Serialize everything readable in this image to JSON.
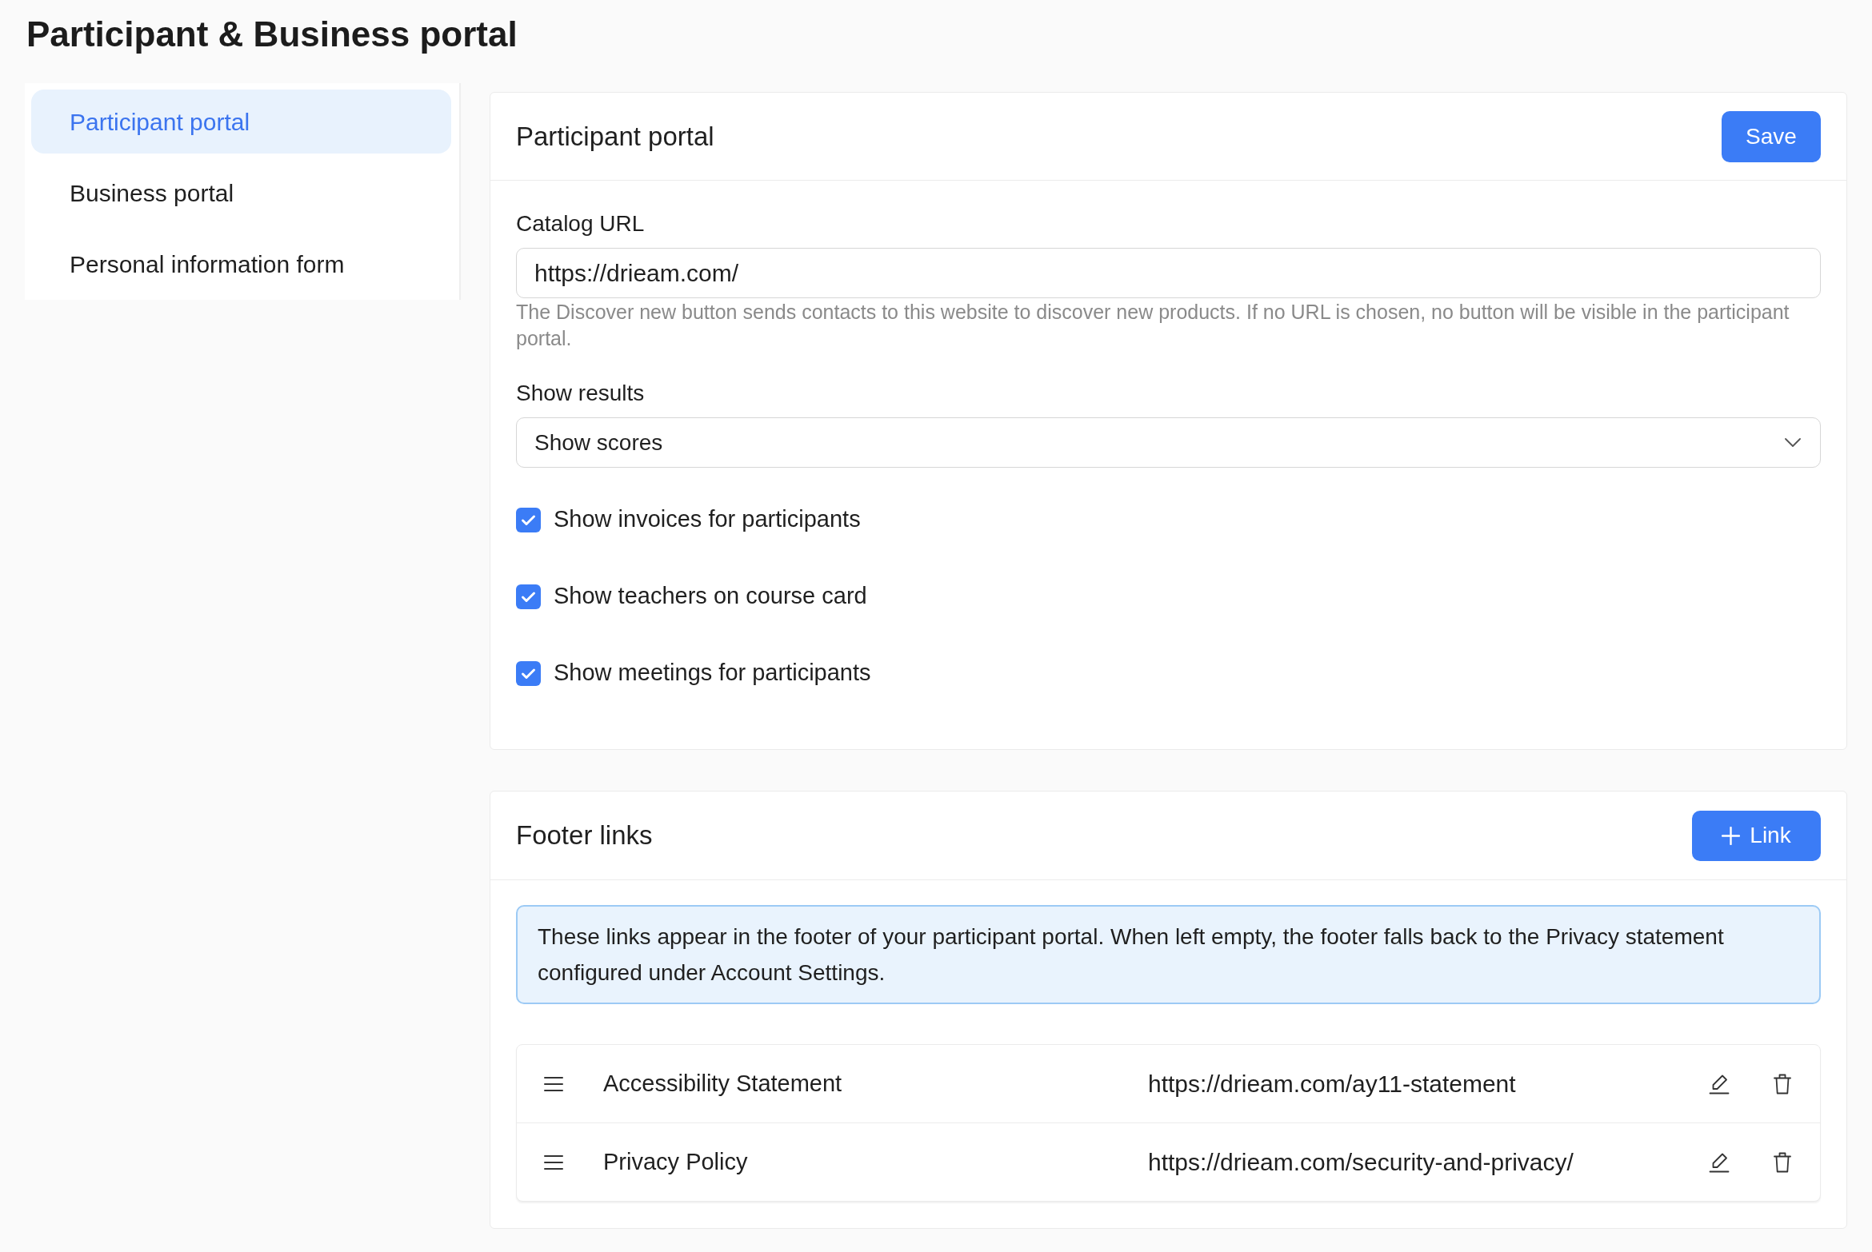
{
  "page": {
    "title": "Participant & Business portal"
  },
  "sidebar": {
    "items": [
      {
        "label": "Participant portal",
        "selected": true
      },
      {
        "label": "Business portal",
        "selected": false
      },
      {
        "label": "Personal information form",
        "selected": false
      }
    ]
  },
  "participant_portal": {
    "title": "Participant portal",
    "save_button": "Save",
    "catalog_url": {
      "label": "Catalog URL",
      "value": "https://drieam.com/",
      "help": "The Discover new button sends contacts to this website to discover new products. If no URL is chosen, no button will be visible in the participant portal."
    },
    "show_results": {
      "label": "Show results",
      "value": "Show scores"
    },
    "options": [
      {
        "label": "Show invoices for participants",
        "checked": true
      },
      {
        "label": "Show teachers on course card",
        "checked": true
      },
      {
        "label": "Show meetings for participants",
        "checked": true
      }
    ]
  },
  "footer_links": {
    "title": "Footer links",
    "add_button": "Link",
    "notice": "These links appear in the footer of your participant portal. When left empty, the footer falls back to the Privacy statement configured under Account Settings.",
    "links": [
      {
        "name": "Accessibility Statement",
        "url": "https://drieam.com/ay11-statement"
      },
      {
        "name": "Privacy Policy",
        "url": "https://drieam.com/security-and-privacy/"
      }
    ]
  }
}
